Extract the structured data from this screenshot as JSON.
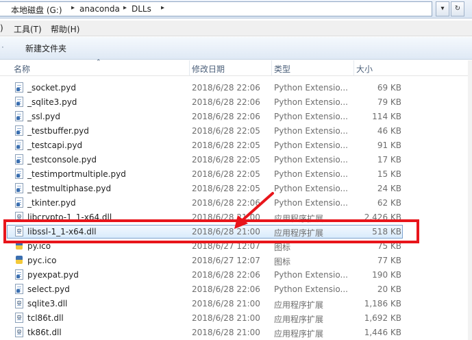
{
  "address": {
    "crumbs": [
      "本地磁盘 (G:)",
      "anaconda",
      "DLLs"
    ],
    "separator": "▸",
    "dropdown_glyph": "▾",
    "refresh_glyph": "↻"
  },
  "menubar": {
    "items": [
      "工具(T)",
      "帮助(H)"
    ],
    "left_fragment": ")"
  },
  "toolbar": {
    "new_folder": "新建文件夹",
    "left_fragment": "·"
  },
  "columns": {
    "name": "名称",
    "date": "修改日期",
    "type": "类型",
    "size": "大小"
  },
  "files": [
    {
      "name": "_socket.pyd",
      "date": "2018/6/28 22:06",
      "type": "Python Extensio...",
      "size": "69 KB",
      "icon": "pyd-file-icon"
    },
    {
      "name": "_sqlite3.pyd",
      "date": "2018/6/28 22:06",
      "type": "Python Extensio...",
      "size": "79 KB",
      "icon": "pyd-file-icon"
    },
    {
      "name": "_ssl.pyd",
      "date": "2018/6/28 22:06",
      "type": "Python Extensio...",
      "size": "114 KB",
      "icon": "pyd-file-icon"
    },
    {
      "name": "_testbuffer.pyd",
      "date": "2018/6/28 22:05",
      "type": "Python Extensio...",
      "size": "46 KB",
      "icon": "pyd-file-icon"
    },
    {
      "name": "_testcapi.pyd",
      "date": "2018/6/28 22:05",
      "type": "Python Extensio...",
      "size": "91 KB",
      "icon": "pyd-file-icon"
    },
    {
      "name": "_testconsole.pyd",
      "date": "2018/6/28 22:05",
      "type": "Python Extensio...",
      "size": "17 KB",
      "icon": "pyd-file-icon"
    },
    {
      "name": "_testimportmultiple.pyd",
      "date": "2018/6/28 22:05",
      "type": "Python Extensio...",
      "size": "15 KB",
      "icon": "pyd-file-icon"
    },
    {
      "name": "_testmultiphase.pyd",
      "date": "2018/6/28 22:05",
      "type": "Python Extensio...",
      "size": "24 KB",
      "icon": "pyd-file-icon"
    },
    {
      "name": "_tkinter.pyd",
      "date": "2018/6/28 22:06",
      "type": "Python Extensio...",
      "size": "62 KB",
      "icon": "pyd-file-icon"
    },
    {
      "name": "libcrypto-1_1-x64.dll",
      "date": "2018/6/28 21:00",
      "type": "应用程序扩展",
      "size": "2,426 KB",
      "icon": "dll-file-icon"
    },
    {
      "name": "libssl-1_1-x64.dll",
      "date": "2018/6/28 21:00",
      "type": "应用程序扩展",
      "size": "518 KB",
      "icon": "dll-file-icon",
      "selected": true
    },
    {
      "name": "py.ico",
      "date": "2018/6/27 12:07",
      "type": "图标",
      "size": "75 KB",
      "icon": "python-ico-icon"
    },
    {
      "name": "pyc.ico",
      "date": "2018/6/27 12:07",
      "type": "图标",
      "size": "77 KB",
      "icon": "python-ico-icon"
    },
    {
      "name": "pyexpat.pyd",
      "date": "2018/6/28 22:06",
      "type": "Python Extensio...",
      "size": "190 KB",
      "icon": "pyd-file-icon"
    },
    {
      "name": "select.pyd",
      "date": "2018/6/28 22:06",
      "type": "Python Extensio...",
      "size": "20 KB",
      "icon": "pyd-file-icon"
    },
    {
      "name": "sqlite3.dll",
      "date": "2018/6/28 21:00",
      "type": "应用程序扩展",
      "size": "1,186 KB",
      "icon": "dll-file-icon"
    },
    {
      "name": "tcl86t.dll",
      "date": "2018/6/28 21:00",
      "type": "应用程序扩展",
      "size": "1,692 KB",
      "icon": "dll-file-icon"
    },
    {
      "name": "tk86t.dll",
      "date": "2018/6/28 21:00",
      "type": "应用程序扩展",
      "size": "1,446 KB",
      "icon": "dll-file-icon"
    }
  ],
  "annotation": {
    "box_color": "#e8151b",
    "arrow_color": "#e8151b"
  }
}
